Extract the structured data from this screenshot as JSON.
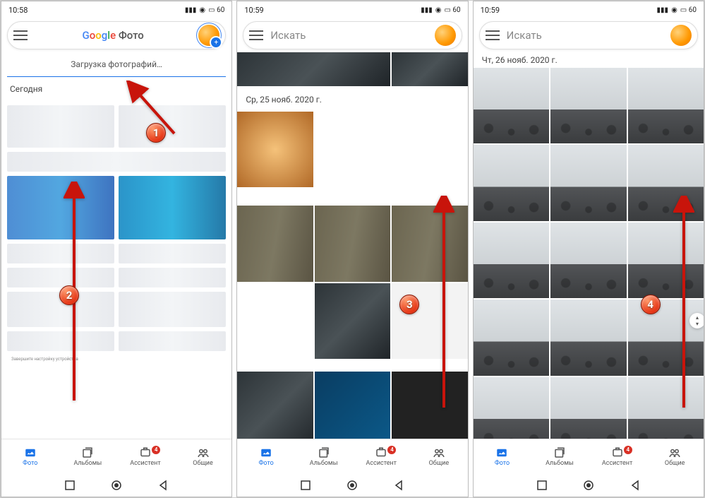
{
  "status": {
    "time1": "10:58",
    "time2": "10:59",
    "time3": "10:59",
    "battery": "60",
    "signal_icon": "signal",
    "wifi_icon": "wifi"
  },
  "search": {
    "google_logo_g": "G",
    "google_logo_o1": "o",
    "google_logo_o2": "o",
    "google_logo_g2": "g",
    "google_logo_l": "l",
    "google_logo_e": "e",
    "app_name": " Фото",
    "placeholder": "Искать"
  },
  "screen1": {
    "banner": "Загрузка фотографий…",
    "section_today": "Сегодня"
  },
  "screen2": {
    "date_header": "Ср, 25 нояб. 2020 г."
  },
  "screen3": {
    "date_header": "Чт, 26 нояб. 2020 г."
  },
  "nav": {
    "photos": "Фото",
    "albums": "Альбомы",
    "assistant": "Ассистент",
    "sharing": "Общие",
    "badge_count": "4"
  },
  "markers": {
    "m1": "1",
    "m2": "2",
    "m3": "3",
    "m4": "4"
  },
  "tiny_hint": "Завершите настройку устройства"
}
